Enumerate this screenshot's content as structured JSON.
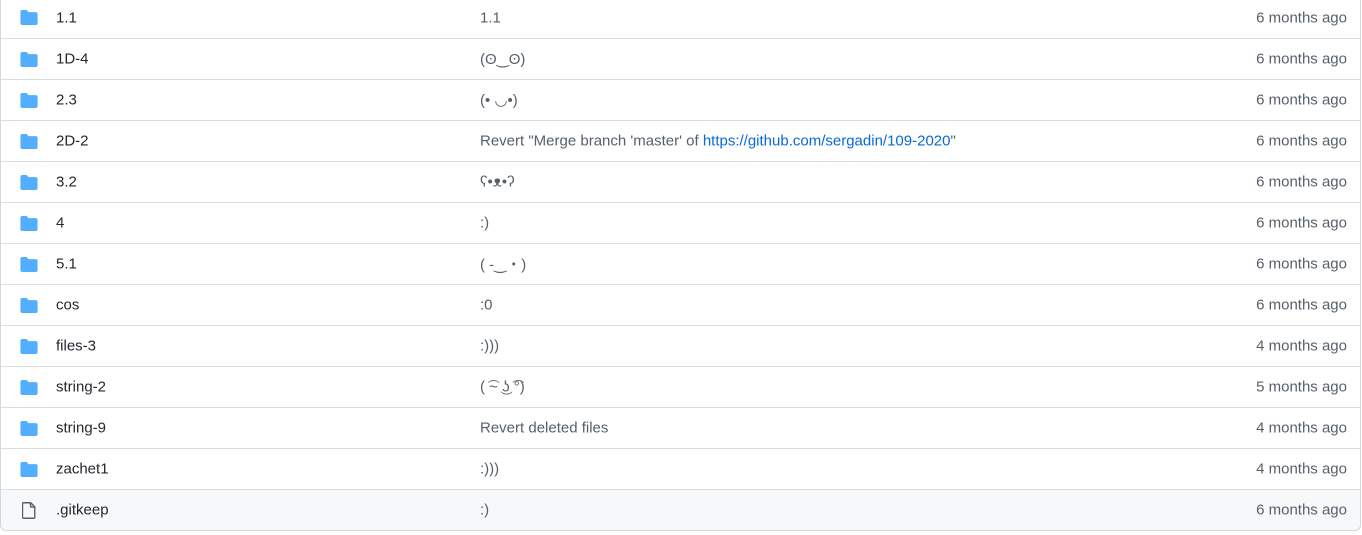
{
  "rows": [
    {
      "type": "dir",
      "icon": "folder-icon",
      "name": "1.1",
      "message": "1.1",
      "age": "6 months ago"
    },
    {
      "type": "dir",
      "icon": "folder-icon",
      "name": "1D-4",
      "message": "(ʘ‿ʘ)",
      "age": "6 months ago"
    },
    {
      "type": "dir",
      "icon": "folder-icon",
      "name": "2.3",
      "message": "(• ◡•)",
      "age": "6 months ago"
    },
    {
      "type": "dir",
      "icon": "folder-icon",
      "name": "2D-2",
      "message_prefix": "Revert \"Merge branch 'master' of ",
      "message_link": "https://github.com/sergadin/109-2020",
      "message_suffix": "\"",
      "age": "6 months ago"
    },
    {
      "type": "dir",
      "icon": "folder-icon",
      "name": "3.2",
      "message": "ʕ•ᴥ•ʔ",
      "age": "6 months ago"
    },
    {
      "type": "dir",
      "icon": "folder-icon",
      "name": "4",
      "message": ":)",
      "age": "6 months ago"
    },
    {
      "type": "dir",
      "icon": "folder-icon",
      "name": "5.1",
      "message": "( -‿・)",
      "age": "6 months ago"
    },
    {
      "type": "dir",
      "icon": "folder-icon",
      "name": "cos",
      "message": ":0",
      "age": "6 months ago"
    },
    {
      "type": "dir",
      "icon": "folder-icon",
      "name": "files-3",
      "message": ":)))",
      "age": "4 months ago"
    },
    {
      "type": "dir",
      "icon": "folder-icon",
      "name": "string-2",
      "message": "( ͡~ ͜ʖ ͡°)",
      "age": "5 months ago"
    },
    {
      "type": "dir",
      "icon": "folder-icon",
      "name": "string-9",
      "message": "Revert deleted files",
      "age": "4 months ago"
    },
    {
      "type": "dir",
      "icon": "folder-icon",
      "name": "zachet1",
      "message": ":)))",
      "age": "4 months ago"
    },
    {
      "type": "file",
      "icon": "file-icon",
      "name": ".gitkeep",
      "message": ":)",
      "age": "6 months ago"
    }
  ],
  "colors": {
    "folder": "#54aeff",
    "file_icon": "#57606a",
    "link": "#0969da",
    "border": "#d8dee4",
    "hover_row": "#f6f8fa"
  }
}
